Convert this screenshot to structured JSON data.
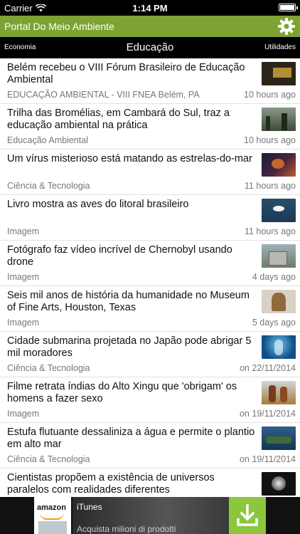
{
  "status_bar": {
    "carrier": "Carrier",
    "time": "1:14 PM",
    "battery_level": 1.0
  },
  "app_bar": {
    "title": "Portal Do Meio Ambiente",
    "settings_icon": "gear-icon",
    "background": "#7ea233"
  },
  "tabs": {
    "left": "Economia",
    "center": "Educação",
    "right": "Utilidades"
  },
  "articles": [
    {
      "headline": "Belém recebeu o VIII Fórum Brasileiro de Educação Ambiental",
      "category": "EDUCAÇÃO AMBIENTAL - VIII FNEA Belém, PA",
      "time": "10 hours ago"
    },
    {
      "headline": "Trilha das Bromélias, em Cambará do Sul, traz a educação ambiental na prática",
      "category": "Educação Ambiental",
      "time": "10 hours ago"
    },
    {
      "headline": "Um vírus misterioso está matando as estrelas-do-mar",
      "category": "Ciência & Tecnologia",
      "time": "11 hours ago"
    },
    {
      "headline": "Livro mostra as aves do litoral brasileiro",
      "category": "Imagem",
      "time": "11 hours ago"
    },
    {
      "headline": "Fotógrafo faz vídeo incrível de Chernobyl usando drone",
      "category": "Imagem",
      "time": "4 days ago"
    },
    {
      "headline": "Seis mil anos de história da humanidade no Museum of Fine Arts, Houston, Texas",
      "category": "Imagem",
      "time": "5 days ago"
    },
    {
      "headline": "Cidade submarina projetada no Japão pode abrigar 5 mil moradores",
      "category": "Ciência & Tecnologia",
      "time": "on 22/11/2014"
    },
    {
      "headline": "Filme retrata índias do Alto Xingu que 'obrigam' os homens a fazer sexo",
      "category": "Imagem",
      "time": "on 19/11/2014"
    },
    {
      "headline": "Estufa flutuante dessaliniza a água e permite o plantio em alto mar",
      "category": "Ciência & Tecnologia",
      "time": "on 19/11/2014"
    },
    {
      "headline": "Cientistas propõem a existência de universos paralelos com realidades diferentes",
      "category": "",
      "time": ""
    }
  ],
  "ad": {
    "brand": "amazon",
    "store": "iTunes",
    "text": "Acquista milioni di prodotti",
    "download_icon": "download-icon"
  }
}
